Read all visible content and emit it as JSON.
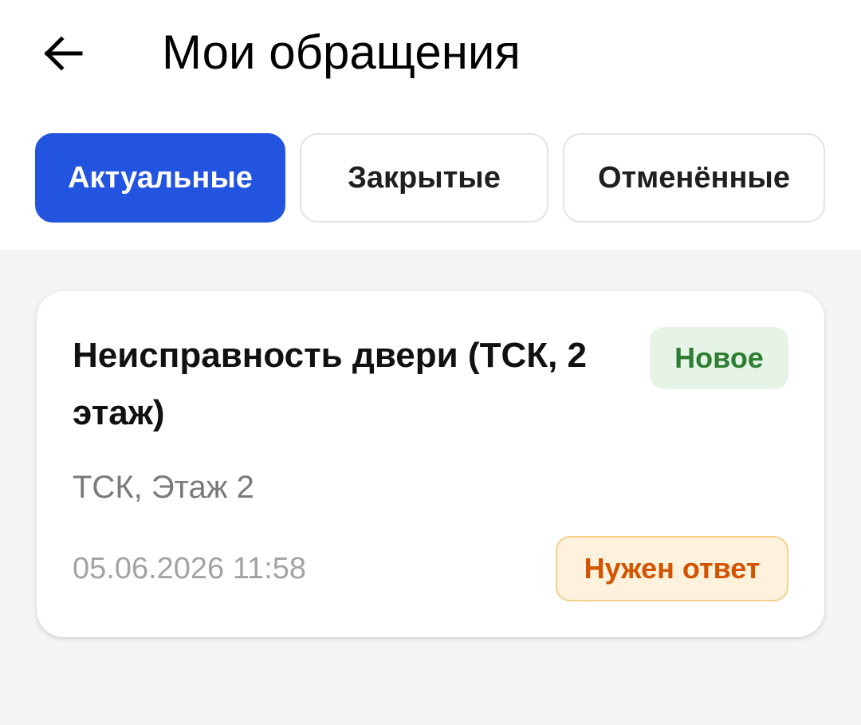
{
  "header": {
    "title": "Мои обращения",
    "back_icon": "arrow-left-icon"
  },
  "tabs": [
    {
      "label": "Актуальные",
      "active": true
    },
    {
      "label": "Закрытые",
      "active": false
    },
    {
      "label": "Отменённые",
      "active": false
    }
  ],
  "tickets": [
    {
      "title": "Неисправность двери (ТСК, 2 этаж)",
      "status": "Новое",
      "location": "ТСК, Этаж 2",
      "datetime": "05.06.2026 11:58",
      "flag": "Нужен ответ"
    }
  ],
  "colors": {
    "accent": "#2354e0",
    "status_new_bg": "#e6f4e8",
    "status_new_text": "#2e7d32",
    "flag_bg": "#fff2dc",
    "flag_text": "#d35400"
  }
}
